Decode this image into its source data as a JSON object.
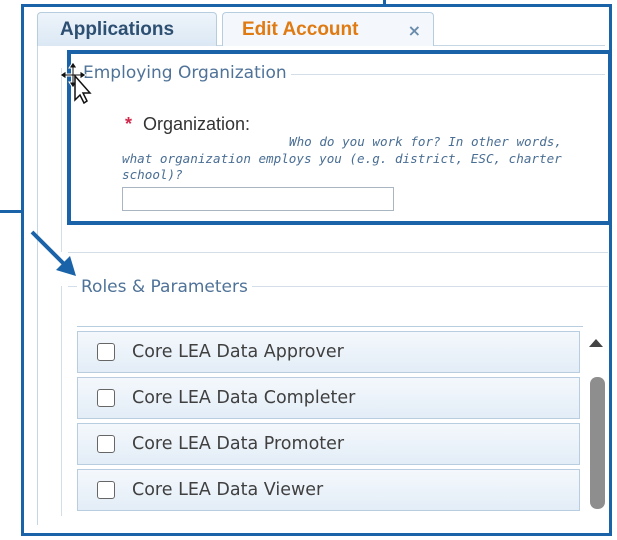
{
  "tabs": [
    {
      "label": "Applications",
      "active": false
    },
    {
      "label": "Edit Account",
      "active": true,
      "close_symbol": "×"
    }
  ],
  "employing_org": {
    "legend": "Employing Organization",
    "required_marker": "*",
    "field_label": "Organization:",
    "hint_line1": "Who do you work for? In other words,",
    "hint_line2": "what organization employs you (e.g. district, ESC, charter",
    "hint_line3": "school)?",
    "input_value": ""
  },
  "roles": {
    "legend": "Roles & Parameters",
    "items": [
      {
        "label": "Core LEA Data Approver",
        "checked": false
      },
      {
        "label": "Core LEA Data Completer",
        "checked": false
      },
      {
        "label": "Core LEA Data Promoter",
        "checked": false
      },
      {
        "label": "Core LEA Data Viewer",
        "checked": false
      }
    ]
  },
  "colors": {
    "annotation_blue": "#1a63a8",
    "active_tab_text": "#e07a12",
    "tab_text": "#2d4f72",
    "required": "#d0284b",
    "legend_text": "#4f7398"
  },
  "icons": [
    "close-icon",
    "move-cursor-icon",
    "annotation-arrow-icon",
    "scroll-up-icon",
    "checkbox-icon"
  ]
}
